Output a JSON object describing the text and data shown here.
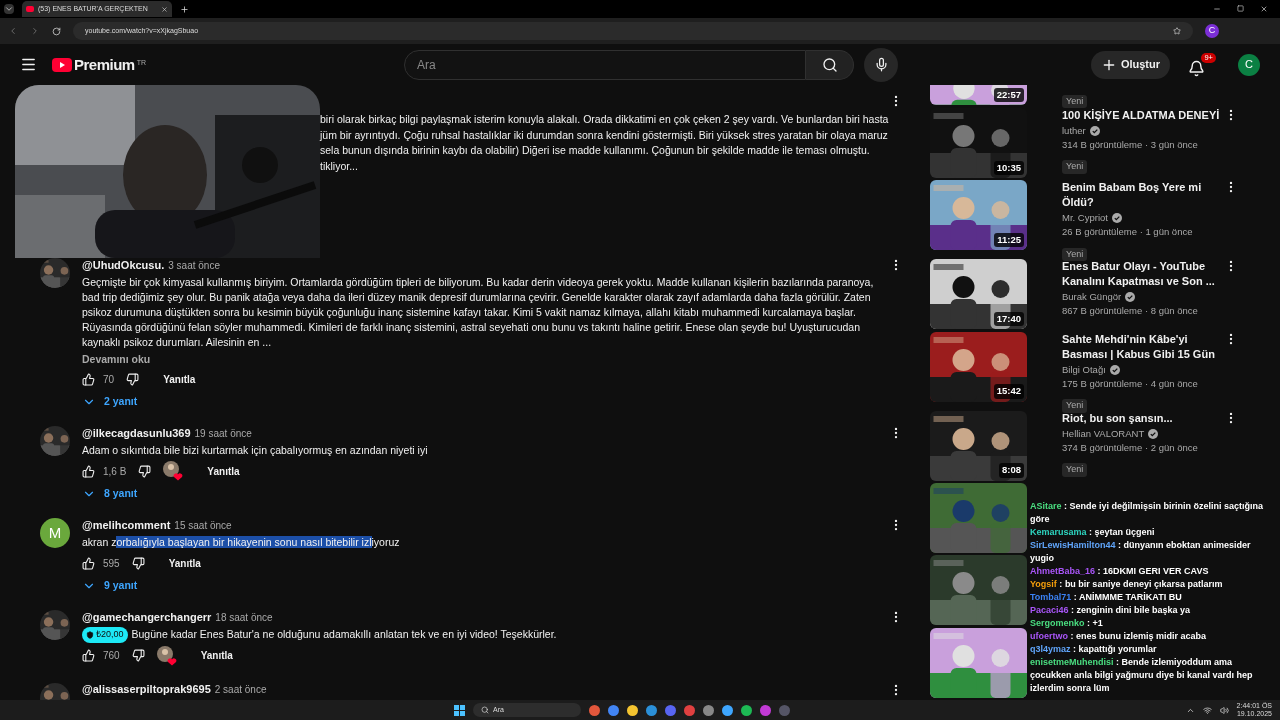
{
  "browser": {
    "tab_title": "(53) ENES BATUR'A GERÇEKTEN",
    "url": "youtube.com/watch?v=xXjkagSbuao",
    "profile": "C"
  },
  "header": {
    "logo": "Premium",
    "region": "TR",
    "search": {
      "placeholder": "Ara"
    },
    "create_button": "Oluştur",
    "notification_badge": "9+",
    "avatar": "C"
  },
  "top_comment_fragment": [
    "biri olarak birkaç bilgi paylaşmak isterim konuyla alakalı. Orada dikkatimi en çok çeken 2 şey vardı. Ve bunlardan biri hasta",
    "jüm bir ayrıntıydı. Çoğu ruhsal hastalıklar iki durumdan sonra kendini göstermişti. Biri yüksek stres yaratan bir olaya maruz",
    "sela bunun dışında birinin kaybı da olabilir) Diğeri ise madde kullanımı. Çoğunun bir şekilde madde ile teması olmuştu.",
    "tikliyor..."
  ],
  "comments": [
    {
      "handle": "@UhudOkcusu.",
      "time": "3 saat önce",
      "text": "Geçmişte bir çok kimyasal kullanmış biriyim. Ortamlarda gördüğüm tipleri de biliyorum. Bu kadar derin videoya gerek yoktu. Madde kullanan kişilerin bazılarında paranoya, bad trip dediğimiz şey olur. Bu panik atağa veya daha da ileri düzey manik depresif durumlarına çevirir. Genelde karakter olarak zayıf adamlarda daha fazla görülür. Zaten psikoz durumuna düştükten sonra bu kesimin büyük çoğunluğu inanç sistemine kafayı takar. Kimi 5 vakit namaz kılmaya, allahı kitabı muhammedi kurcalamaya başlar. Rüyasında gördüğünü felan söyler muhammedi. Kimileri de farklı inanç sistemini, astral seyehati onu bunu vs takıntı haline getirir. Enese olan şeyde bu! Uyuşturucudan kaynaklı psikoz durumları. Ailesinin en ...",
      "read_more": "Devamını oku",
      "likes": "70",
      "creator_heart": false,
      "reply_label": "Yanıtla",
      "replies": "2 yanıt"
    },
    {
      "handle": "@ilkecagdasunlu369",
      "time": "19 saat önce",
      "text": "Adam o sıkıntıda bile bizi kurtarmak için çabalıyormuş en azından niyeti iyi",
      "likes": "1,6 B",
      "creator_heart": true,
      "reply_label": "Yanıtla",
      "replies": "8 yanıt"
    },
    {
      "avatar": {
        "kind": "letter",
        "letter": "M",
        "color": "#6aa83c"
      },
      "handle": "@melihcomment",
      "time": "15 saat önce",
      "text_parts": [
        {
          "text": "akran z",
          "selected": false
        },
        {
          "text": "orbalığıyla başlayan bir hikayenin sonu nasıl bitebilir izl",
          "selected": true
        },
        {
          "text": "iyoruz",
          "selected": false
        }
      ],
      "likes": "595",
      "creator_heart": false,
      "reply_label": "Yanıtla",
      "replies": "9 yanıt"
    },
    {
      "handle": "@gamechangerchangerr",
      "time": "18 saat önce",
      "super_thanks": "₺20,00",
      "text": "Bugüne kadar Enes Batur'a ne olduğunu adamakıllı anlatan tek ve en iyi video! Teşekkürler.",
      "likes": "760",
      "creator_heart": true,
      "reply_label": "Yanıtla"
    },
    {
      "handle": "@alissaserpiltoprak9695",
      "time": "2 saat önce"
    }
  ],
  "sidebar": {
    "partial_item": {
      "duration": "22:57",
      "badge": "Yeni"
    },
    "videos": [
      {
        "title": "100 KİŞİYE ALDATMA DENEYİ",
        "channel": "luther",
        "verified": true,
        "meta": "314 B görüntüleme · 3 gün önce",
        "badge": "Yeni",
        "duration": "10:35"
      },
      {
        "title": "Benim Babam Boş Yere mi Öldü?",
        "channel": "Mr. Cypriot",
        "verified": true,
        "meta": "26 B görüntüleme · 1 gün önce",
        "badge": "Yeni",
        "duration": "11:25"
      },
      {
        "title": "Enes Batur Olayı - YouTube Kanalını Kapatması ve Son ...",
        "channel": "Burak Güngör",
        "verified": true,
        "meta": "867 B görüntüleme · 8 gün önce",
        "duration": "17:40"
      },
      {
        "title": "Sahte Mehdi'nin Kâbe'yi Basması | Kabus Gibi 15 Gün",
        "channel": "Bilgi Otağı",
        "verified": true,
        "meta": "175 B görüntüleme · 4 gün önce",
        "badge": "Yeni",
        "duration": "15:42"
      },
      {
        "title": "Riot, bu son şansın...",
        "channel": "Hellian VALORANT",
        "verified": true,
        "meta": "374 B görüntüleme · 2 gün önce",
        "badge": "Yeni",
        "duration": "8:08"
      }
    ]
  },
  "chat": [
    {
      "user": "ASitare",
      "color": "#4ade80",
      "separator": ":",
      "text": "Sende iyi değilmişsin birinin özelini saçtığına göre"
    },
    {
      "user": "Kemarusama",
      "color": "#2dd4bf",
      "separator": ":",
      "text": "şeytan üçgeni"
    },
    {
      "user": "SirLewisHamilton44",
      "color": "#60a5fa",
      "separator": ":",
      "text": "dünyanın eboktan animesider yugio"
    },
    {
      "user": "AhmetBaba_16",
      "color": "#a855f7",
      "separator": ":",
      "text": "16DKMI GERI VER CAVS"
    },
    {
      "user": "Yogsif",
      "color": "#f59e0b",
      "separator": ":",
      "text": "bu bir saniye deneyi çıkarsa patlarım"
    },
    {
      "user": "Tombal71",
      "color": "#3b82f6",
      "separator": ":",
      "text": "ANİMMME TARİKATI BU"
    },
    {
      "user": "Pacaci46",
      "color": "#a855f7",
      "separator": ":",
      "text": "zenginin dini bile başka ya"
    },
    {
      "user": "Sergomenko",
      "color": "#4ade80",
      "separator": ":",
      "text": "+1"
    },
    {
      "user": "ufoertwo",
      "color": "#a855f7",
      "separator": ":",
      "text": "enes bunu izlemiş midir acaba"
    },
    {
      "user": "q3l4ymaz",
      "color": "#60a5fa",
      "separator": ":",
      "text": "kapattığı yorumlar"
    },
    {
      "user": "enisetmeMuhendisi",
      "color": "#4ade80",
      "separator": ":",
      "text": "Bende izlemiyoddum ama çocukken anla bilgi yağmuru diye bi kanal vardı hep izlerdim sonra lüm"
    }
  ],
  "taskbar": {
    "search_placeholder": "Ara",
    "time": "2:44:01 ÖS",
    "date": "19.10.2025"
  }
}
